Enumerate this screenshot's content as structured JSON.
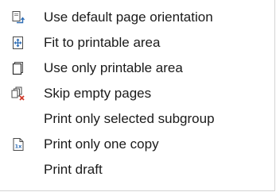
{
  "menu": {
    "items": [
      {
        "label": "Use default page orientation",
        "icon": "page-orientation-icon"
      },
      {
        "label": "Fit to printable area",
        "icon": "fit-to-area-icon"
      },
      {
        "label": "Use only printable area",
        "icon": "printable-area-icon"
      },
      {
        "label": "Skip empty pages",
        "icon": "skip-empty-pages-icon"
      },
      {
        "label": "Print only selected subgroup",
        "icon": ""
      },
      {
        "label": "Print only one copy",
        "icon": "one-copy-icon"
      },
      {
        "label": "Print draft",
        "icon": ""
      }
    ]
  },
  "colors": {
    "text": "#1a1a1a",
    "icon_blue": "#2e6db5",
    "icon_red": "#d03a2a",
    "icon_outline": "#4a4a4a"
  }
}
